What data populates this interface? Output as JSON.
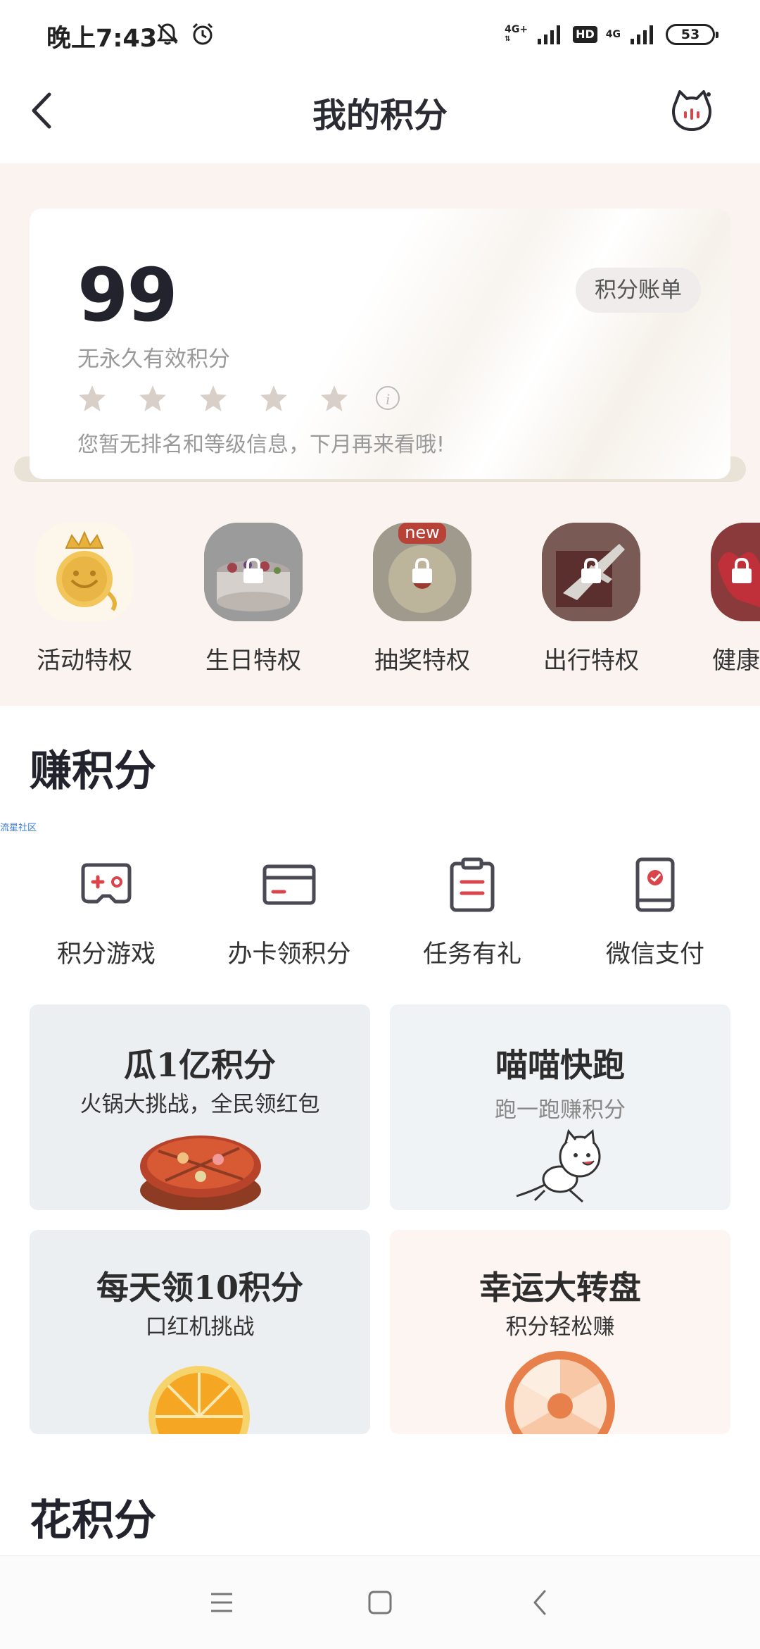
{
  "status_bar": {
    "time": "晚上7:43",
    "network_1": "4G+",
    "network_hd": "HD",
    "network_2": "4G",
    "battery": "53"
  },
  "header": {
    "title": "我的积分"
  },
  "points": {
    "value": "99",
    "subtitle": "无永久有效积分",
    "bill_button": "积分账单",
    "rank_note": "您暂无排名和等级信息，下月再来看哦!",
    "info_glyph": "i",
    "stars_filled": 0
  },
  "privileges": [
    {
      "label": "活动特权",
      "locked": false
    },
    {
      "label": "生日特权",
      "locked": true
    },
    {
      "label": "抽奖特权",
      "locked": true,
      "badge": "new"
    },
    {
      "label": "出行特权",
      "locked": true
    },
    {
      "label": "健康",
      "locked": true
    }
  ],
  "earn": {
    "title": "赚积分",
    "tiny_tag": "流星社区",
    "items": [
      {
        "label": "积分游戏",
        "icon": "gamepad-icon"
      },
      {
        "label": "办卡领积分",
        "icon": "card-icon"
      },
      {
        "label": "任务有礼",
        "icon": "clipboard-icon"
      },
      {
        "label": "微信支付",
        "icon": "phone-pay-icon"
      }
    ],
    "cards": [
      {
        "title": "瓜1亿积分",
        "subtitle": "火锅大挑战，全民领红包"
      },
      {
        "title": "喵喵快跑",
        "subtitle": "跑一跑赚积分"
      },
      {
        "title": "每天领10积分",
        "subtitle": "口红机挑战"
      },
      {
        "title": "幸运大转盘",
        "subtitle": "积分轻松赚"
      }
    ]
  },
  "spend": {
    "title": "花积分"
  },
  "colors": {
    "page_bg_top": "#fbf3ef",
    "accent_red": "#d9454a",
    "icon_dark": "#4a4a55"
  }
}
